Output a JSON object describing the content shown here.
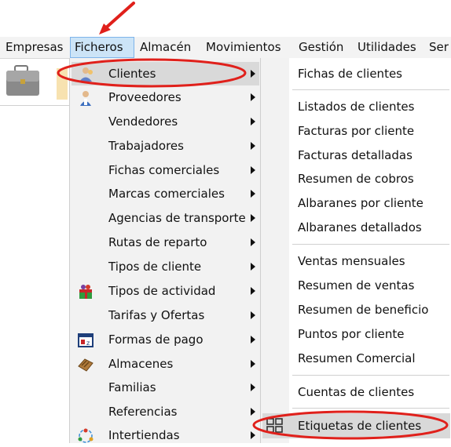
{
  "menubar": {
    "items": [
      {
        "label": "Empresas"
      },
      {
        "label": "Ficheros"
      },
      {
        "label": "Almacén"
      },
      {
        "label": "Movimientos"
      },
      {
        "label": "Gestión"
      },
      {
        "label": "Utilidades"
      },
      {
        "label": "Ser"
      }
    ]
  },
  "ficheros_menu": {
    "items": [
      {
        "label": "Clientes",
        "icon": "clients-icon",
        "highlighted": true
      },
      {
        "label": "Proveedores",
        "icon": "supplier-icon"
      },
      {
        "label": "Vendedores"
      },
      {
        "label": "Trabajadores"
      },
      {
        "label": "Fichas comerciales"
      },
      {
        "label": "Marcas comerciales"
      },
      {
        "label": "Agencias de transporte"
      },
      {
        "label": "Rutas de reparto"
      },
      {
        "label": "Tipos de cliente"
      },
      {
        "label": "Tipos de actividad",
        "icon": "gift-icon"
      },
      {
        "label": "Tarifas y Ofertas"
      },
      {
        "label": "Formas de pago",
        "icon": "payment-form-icon"
      },
      {
        "label": "Almacenes",
        "icon": "warehouse-icon"
      },
      {
        "label": "Familias"
      },
      {
        "label": "Referencias"
      },
      {
        "label": "Intertiendas",
        "icon": "intertiendas-icon"
      }
    ]
  },
  "clientes_submenu": {
    "items": [
      {
        "label": "Fichas de clientes"
      },
      {
        "label": "Listados de clientes"
      },
      {
        "label": "Facturas por cliente"
      },
      {
        "label": "Facturas detalladas"
      },
      {
        "label": "Resumen de cobros"
      },
      {
        "label": "Albaranes por cliente"
      },
      {
        "label": "Albaranes detallados"
      },
      {
        "label": "Ventas mensuales"
      },
      {
        "label": "Resumen de ventas"
      },
      {
        "label": "Resumen de beneficio"
      },
      {
        "label": "Puntos por cliente"
      },
      {
        "label": "Resumen Comercial"
      },
      {
        "label": "Cuentas de clientes"
      },
      {
        "label": "Etiquetas de clientes",
        "icon": "grid-icon",
        "highlighted": true
      }
    ]
  },
  "colors": {
    "annotation_red": "#e0201b",
    "menubar_bg": "#f3f3f3",
    "highlight_bg": "#d9d9d9",
    "open_menu_bg": "#cce4f7"
  }
}
